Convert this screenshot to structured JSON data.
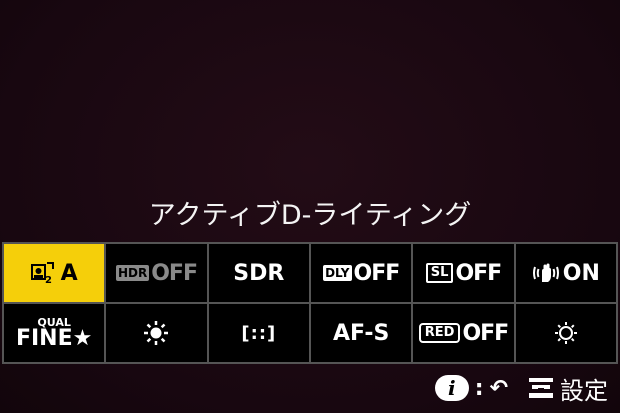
{
  "title": "アクティブD-ライティング",
  "cells": {
    "c1": {
      "label": "A"
    },
    "c2": {
      "badge": "HDR",
      "label": "OFF"
    },
    "c3": {
      "label": "SDR"
    },
    "c4": {
      "badge": "DLY",
      "label": "OFF"
    },
    "c5": {
      "badge": "SL",
      "label": "OFF"
    },
    "c6": {
      "label": "ON"
    },
    "c7": {
      "small": "QUAL",
      "label": "FINE★"
    },
    "c8": {},
    "c9": {
      "label": "[::]"
    },
    "c10": {
      "label": "AF-S"
    },
    "c11": {
      "badge": "RED",
      "label": "OFF"
    },
    "c12": {}
  },
  "footer": {
    "info_key": "i",
    "back_symbol": "↶",
    "settings_label": "設定"
  },
  "colors": {
    "selected": "#f5cf0a",
    "background": "#1a0810",
    "grid_line": "#555555"
  }
}
